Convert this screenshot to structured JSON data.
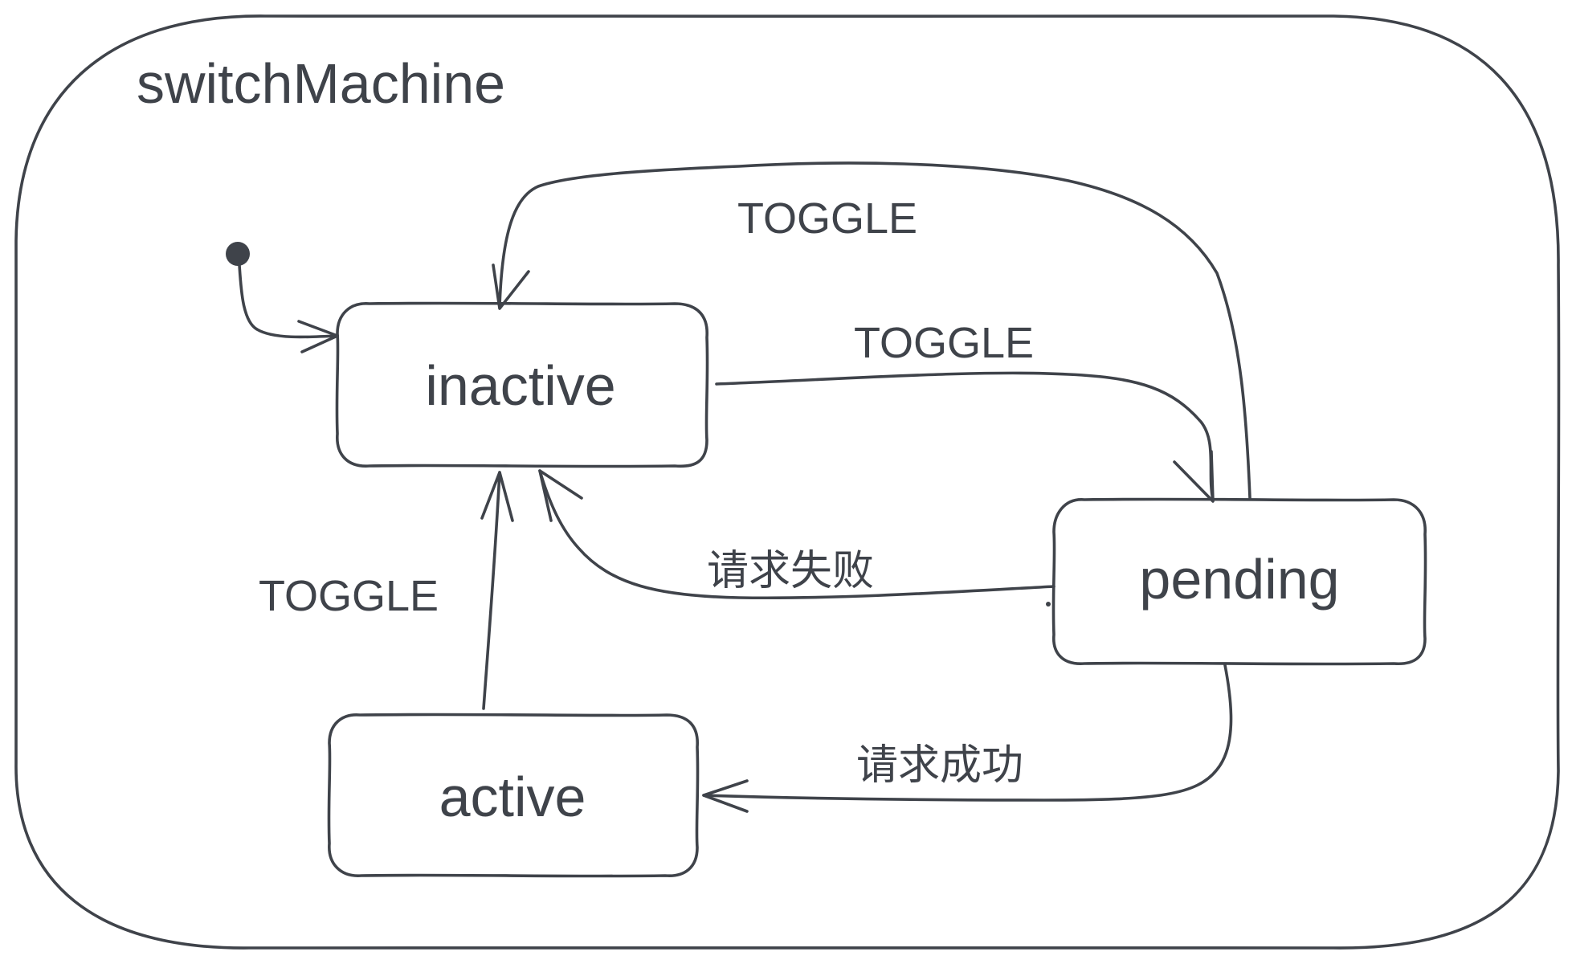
{
  "machine": {
    "name": "switchMachine"
  },
  "states": {
    "inactive": {
      "label": "inactive"
    },
    "pending": {
      "label": "pending"
    },
    "active": {
      "label": "active"
    }
  },
  "transitions": {
    "pending_to_inactive_top": {
      "label": "TOGGLE"
    },
    "inactive_to_pending": {
      "label": "TOGGLE"
    },
    "pending_to_inactive_fail": {
      "label": "请求失败"
    },
    "active_to_inactive": {
      "label": "TOGGLE"
    },
    "pending_to_active_success": {
      "label": "请求成功"
    }
  },
  "colors": {
    "stroke": "#3f434a",
    "background": "#ffffff"
  }
}
